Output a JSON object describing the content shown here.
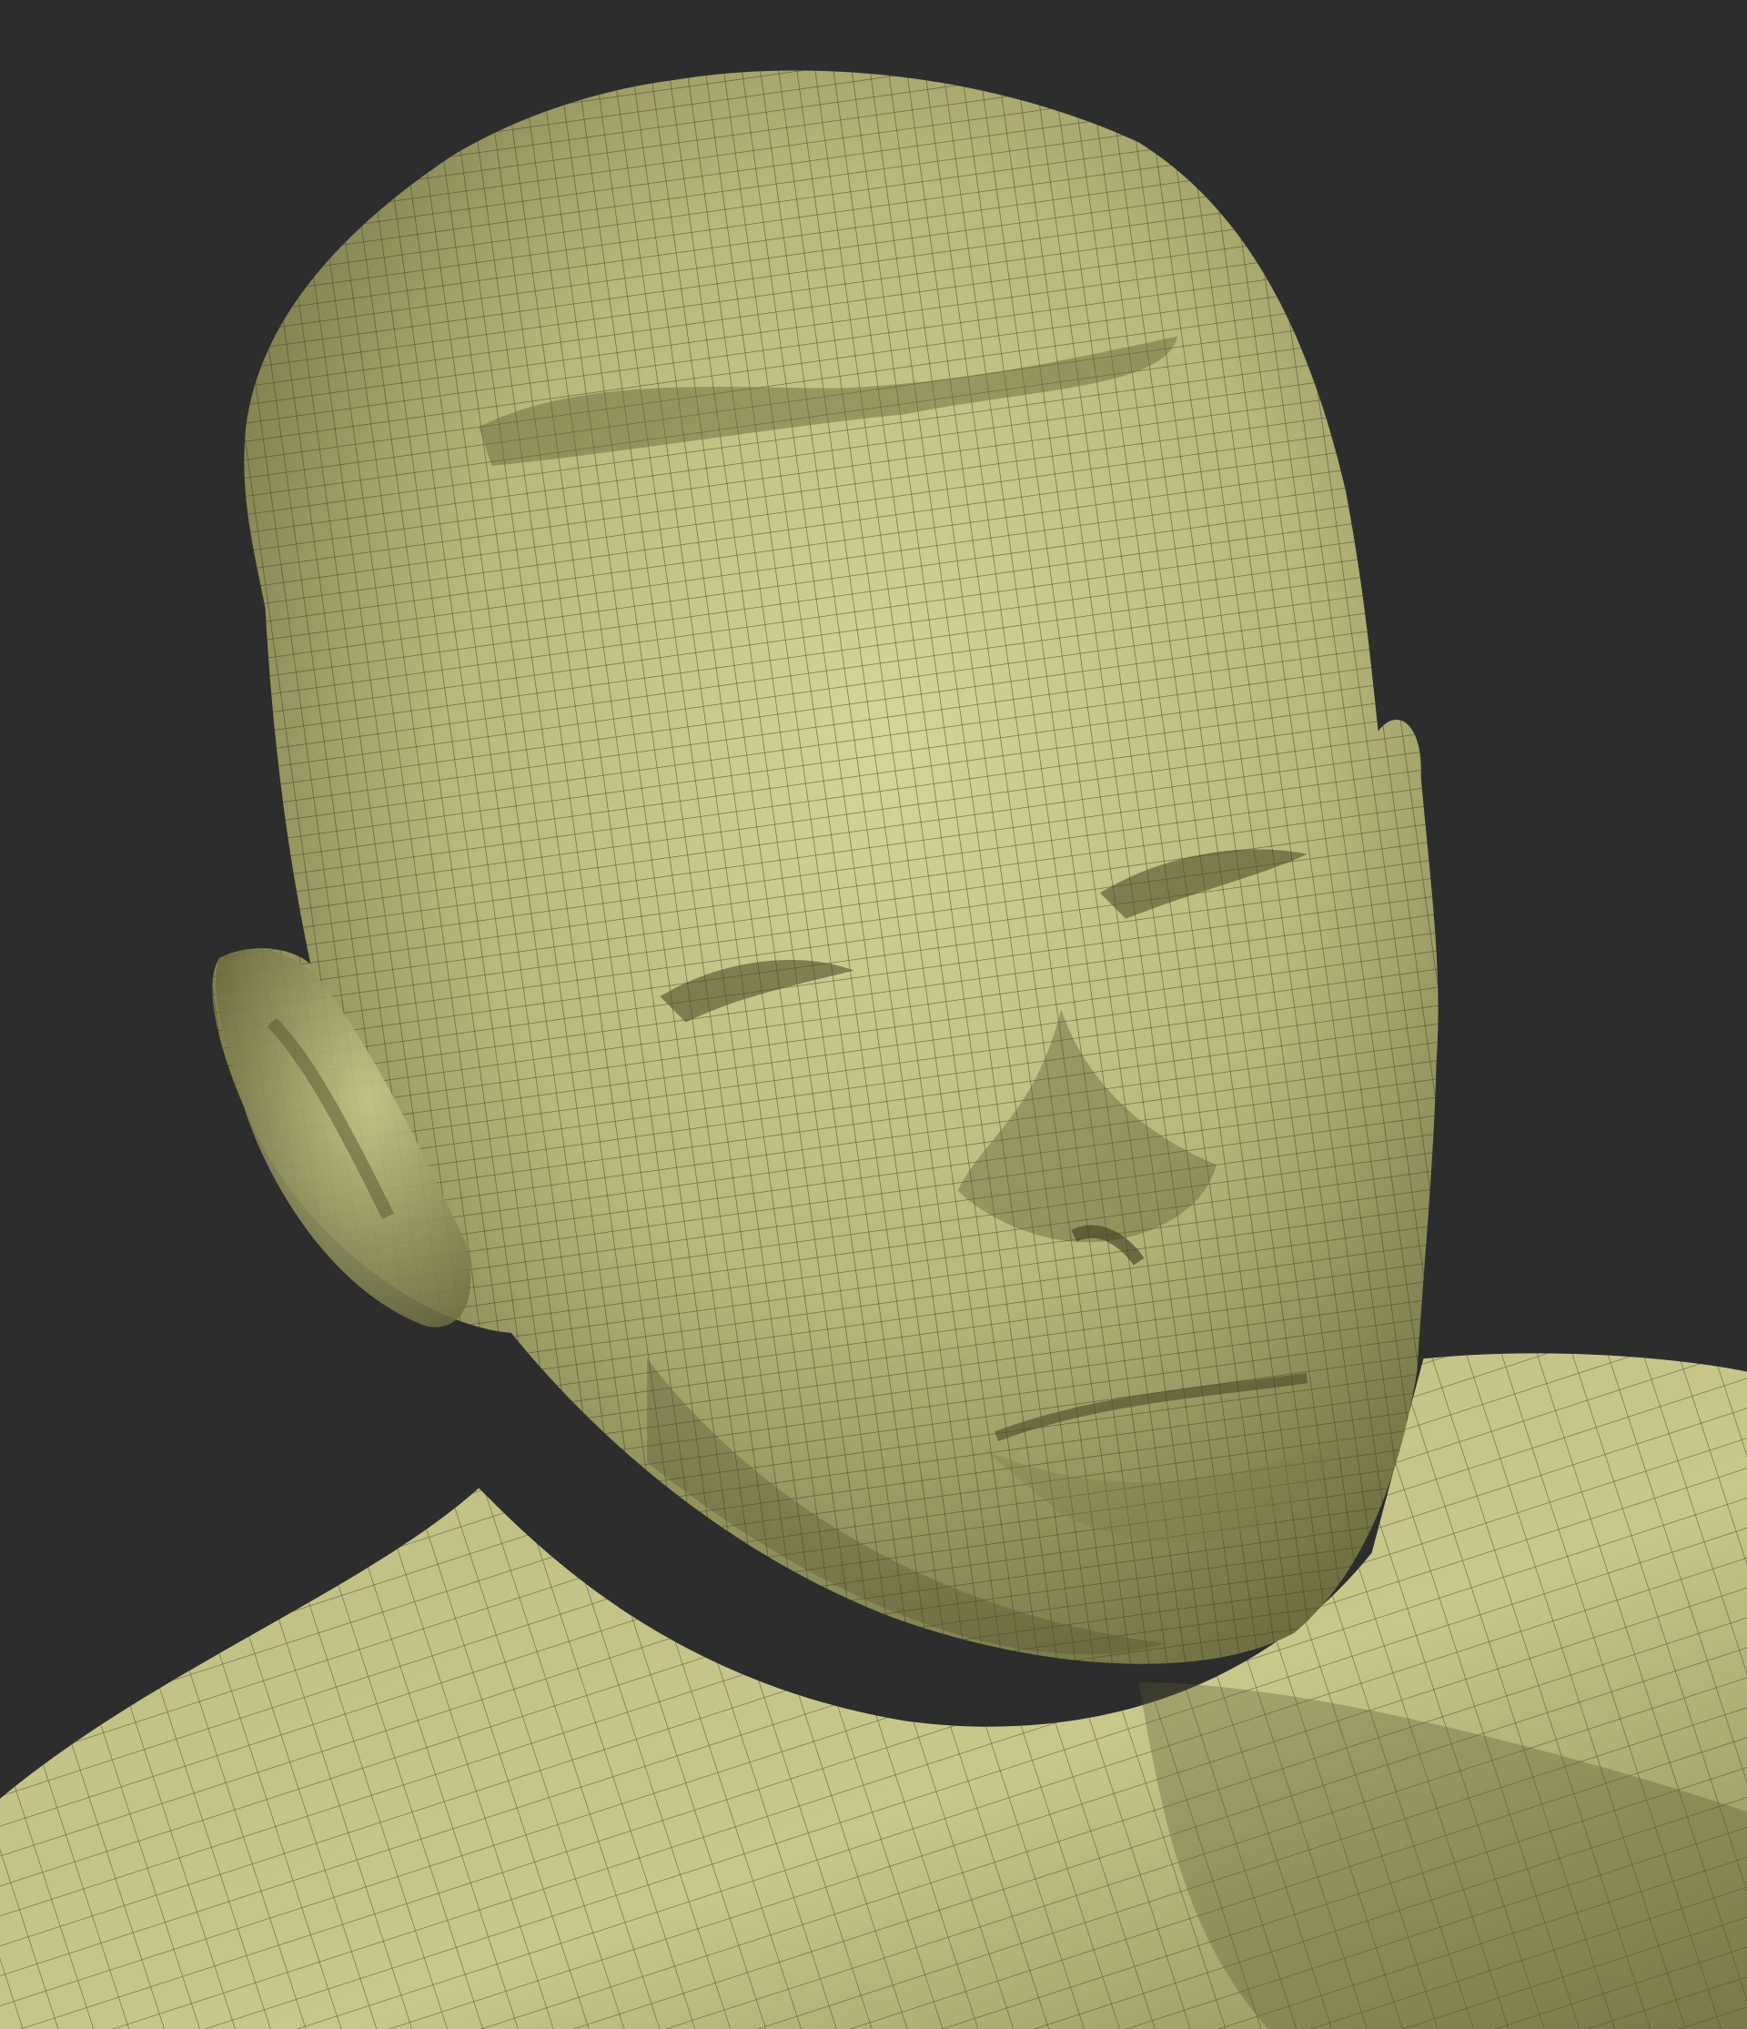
{
  "scene": {
    "subject": "head-bust-wireframe",
    "colors": {
      "background": "#2d2d2d",
      "surface": "#c4c488",
      "surface_shadow": "#6e6e40",
      "wire": "#3f3f28"
    }
  }
}
